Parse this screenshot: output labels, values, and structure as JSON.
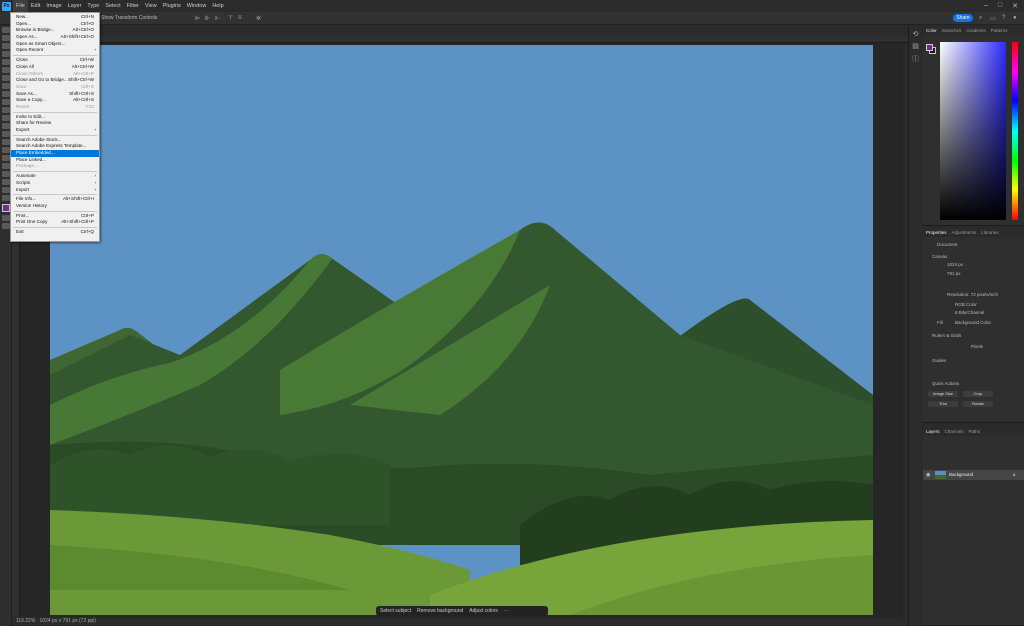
{
  "menubar": {
    "items": [
      "File",
      "Edit",
      "Image",
      "Layer",
      "Type",
      "Select",
      "Filter",
      "View",
      "Plugins",
      "Window",
      "Help"
    ]
  },
  "optbar": {
    "show_transform": "Show Transform Controls",
    "share_label": "Share"
  },
  "file_menu": {
    "items": [
      {
        "label": "New...",
        "shortcut": "Ctrl+N",
        "disabled": false
      },
      {
        "label": "Open...",
        "shortcut": "Ctrl+O",
        "disabled": false
      },
      {
        "label": "Browse in Bridge...",
        "shortcut": "Alt+Ctrl+O",
        "disabled": false
      },
      {
        "label": "Open As...",
        "shortcut": "Alt+Shift+Ctrl+O",
        "disabled": false
      },
      {
        "label": "Open as Smart Object...",
        "shortcut": "",
        "disabled": false
      },
      {
        "label": "Open Recent",
        "shortcut": "",
        "disabled": false,
        "submenu": true
      },
      {
        "sep": true
      },
      {
        "label": "Close",
        "shortcut": "Ctrl+W",
        "disabled": false
      },
      {
        "label": "Close All",
        "shortcut": "Alt+Ctrl+W",
        "disabled": false
      },
      {
        "label": "Close Others",
        "shortcut": "Alt+Ctrl+P",
        "disabled": true
      },
      {
        "label": "Close and Go to Bridge...",
        "shortcut": "Shift+Ctrl+W",
        "disabled": false
      },
      {
        "label": "Save",
        "shortcut": "Ctrl+S",
        "disabled": true
      },
      {
        "label": "Save As...",
        "shortcut": "Shift+Ctrl+S",
        "disabled": false
      },
      {
        "label": "Save a Copy...",
        "shortcut": "Alt+Ctrl+S",
        "disabled": false
      },
      {
        "label": "Revert",
        "shortcut": "F12",
        "disabled": true
      },
      {
        "sep": true
      },
      {
        "label": "Invite to Edit...",
        "shortcut": "",
        "disabled": false
      },
      {
        "label": "Share for Review",
        "shortcut": "",
        "disabled": false
      },
      {
        "label": "Export",
        "shortcut": "",
        "disabled": false,
        "submenu": true
      },
      {
        "sep": true
      },
      {
        "label": "Search Adobe Stock...",
        "shortcut": "",
        "disabled": false
      },
      {
        "label": "Search Adobe Express Template...",
        "shortcut": "",
        "disabled": false
      },
      {
        "label": "Place Embedded...",
        "shortcut": "",
        "disabled": false,
        "highlighted": true
      },
      {
        "label": "Place Linked...",
        "shortcut": "",
        "disabled": false
      },
      {
        "label": "Package...",
        "shortcut": "",
        "disabled": true
      },
      {
        "sep": true
      },
      {
        "label": "Automate",
        "shortcut": "",
        "disabled": false,
        "submenu": true
      },
      {
        "label": "Scripts",
        "shortcut": "",
        "disabled": false,
        "submenu": true
      },
      {
        "label": "Import",
        "shortcut": "",
        "disabled": false,
        "submenu": true
      },
      {
        "sep": true
      },
      {
        "label": "File Info...",
        "shortcut": "Alt+Shift+Ctrl+I",
        "disabled": false
      },
      {
        "label": "Version History",
        "shortcut": "",
        "disabled": false
      },
      {
        "sep": true
      },
      {
        "label": "Print...",
        "shortcut": "Ctrl+P",
        "disabled": false
      },
      {
        "label": "Print One Copy",
        "shortcut": "Alt+Shift+Ctrl+P",
        "disabled": false
      },
      {
        "sep": true
      },
      {
        "label": "Exit",
        "shortcut": "Ctrl+Q",
        "disabled": false
      }
    ]
  },
  "color_panel": {
    "tabs": [
      "Color",
      "Swatches",
      "Gradients",
      "Patterns"
    ],
    "foreground": "#6e2d91"
  },
  "properties_panel": {
    "tabs": [
      "Properties",
      "Adjustments",
      "Libraries"
    ],
    "doc_label": "Document",
    "canvas_label": "Canvas",
    "width_value": "1024 px",
    "height_value": "791 px",
    "resolution": "Resolution: 72 pixels/inch",
    "mode": "RGB Color",
    "depth": "8 Bits/Channel",
    "fill_label": "Fill",
    "fill_value": "Background Color",
    "rulers_label": "Rulers & Grids",
    "pixels_unit": "Pixels",
    "guides_label": "Guides",
    "quick_label": "Quick Actions",
    "buttons": [
      "Image Size",
      "Crop",
      "Trim",
      "Rotate"
    ]
  },
  "layers_panel": {
    "tabs": [
      "Layers",
      "Channels",
      "Paths"
    ],
    "layer_name": "Background"
  },
  "taskbar": {
    "items": [
      "Select subject",
      "Remove background",
      "Adjust colors"
    ]
  },
  "status": {
    "zoom": "116.22%",
    "size": "1024 px x 791 px (72 ppi)"
  }
}
